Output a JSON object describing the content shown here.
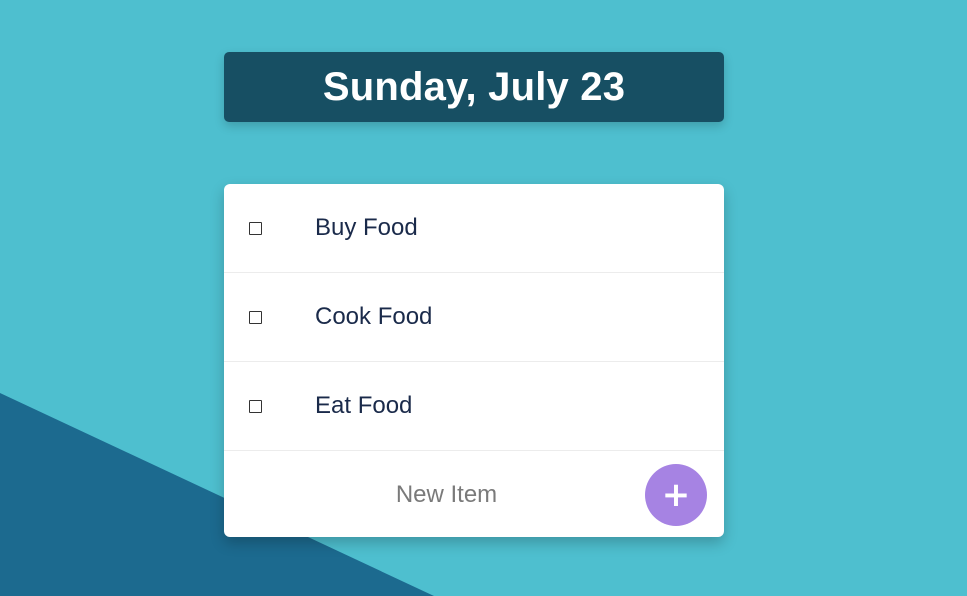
{
  "colors": {
    "background": "#4ebfcf",
    "background_shape": "#1c6a8f",
    "title_bg": "#174f63",
    "card_bg": "#ffffff",
    "add_button": "#a683e3",
    "item_text": "#1a2a4a"
  },
  "header": {
    "title": "Sunday, July 23"
  },
  "todo": {
    "items": [
      {
        "label": "Buy Food",
        "checked": false
      },
      {
        "label": "Cook Food",
        "checked": false
      },
      {
        "label": "Eat Food",
        "checked": false
      }
    ],
    "new_item": {
      "placeholder": "New Item",
      "value": ""
    },
    "add_button": {
      "label": "+",
      "icon": "plus-icon"
    }
  }
}
